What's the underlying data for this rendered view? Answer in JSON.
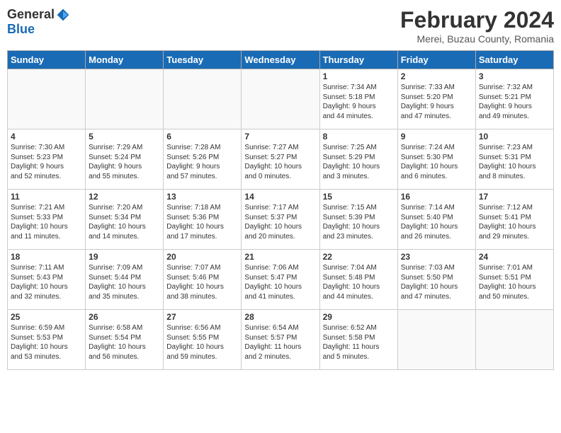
{
  "header": {
    "logo_general": "General",
    "logo_blue": "Blue",
    "month_year": "February 2024",
    "location": "Merei, Buzau County, Romania"
  },
  "weekdays": [
    "Sunday",
    "Monday",
    "Tuesday",
    "Wednesday",
    "Thursday",
    "Friday",
    "Saturday"
  ],
  "weeks": [
    [
      {
        "day": "",
        "info": ""
      },
      {
        "day": "",
        "info": ""
      },
      {
        "day": "",
        "info": ""
      },
      {
        "day": "",
        "info": ""
      },
      {
        "day": "1",
        "info": "Sunrise: 7:34 AM\nSunset: 5:18 PM\nDaylight: 9 hours\nand 44 minutes."
      },
      {
        "day": "2",
        "info": "Sunrise: 7:33 AM\nSunset: 5:20 PM\nDaylight: 9 hours\nand 47 minutes."
      },
      {
        "day": "3",
        "info": "Sunrise: 7:32 AM\nSunset: 5:21 PM\nDaylight: 9 hours\nand 49 minutes."
      }
    ],
    [
      {
        "day": "4",
        "info": "Sunrise: 7:30 AM\nSunset: 5:23 PM\nDaylight: 9 hours\nand 52 minutes."
      },
      {
        "day": "5",
        "info": "Sunrise: 7:29 AM\nSunset: 5:24 PM\nDaylight: 9 hours\nand 55 minutes."
      },
      {
        "day": "6",
        "info": "Sunrise: 7:28 AM\nSunset: 5:26 PM\nDaylight: 9 hours\nand 57 minutes."
      },
      {
        "day": "7",
        "info": "Sunrise: 7:27 AM\nSunset: 5:27 PM\nDaylight: 10 hours\nand 0 minutes."
      },
      {
        "day": "8",
        "info": "Sunrise: 7:25 AM\nSunset: 5:29 PM\nDaylight: 10 hours\nand 3 minutes."
      },
      {
        "day": "9",
        "info": "Sunrise: 7:24 AM\nSunset: 5:30 PM\nDaylight: 10 hours\nand 6 minutes."
      },
      {
        "day": "10",
        "info": "Sunrise: 7:23 AM\nSunset: 5:31 PM\nDaylight: 10 hours\nand 8 minutes."
      }
    ],
    [
      {
        "day": "11",
        "info": "Sunrise: 7:21 AM\nSunset: 5:33 PM\nDaylight: 10 hours\nand 11 minutes."
      },
      {
        "day": "12",
        "info": "Sunrise: 7:20 AM\nSunset: 5:34 PM\nDaylight: 10 hours\nand 14 minutes."
      },
      {
        "day": "13",
        "info": "Sunrise: 7:18 AM\nSunset: 5:36 PM\nDaylight: 10 hours\nand 17 minutes."
      },
      {
        "day": "14",
        "info": "Sunrise: 7:17 AM\nSunset: 5:37 PM\nDaylight: 10 hours\nand 20 minutes."
      },
      {
        "day": "15",
        "info": "Sunrise: 7:15 AM\nSunset: 5:39 PM\nDaylight: 10 hours\nand 23 minutes."
      },
      {
        "day": "16",
        "info": "Sunrise: 7:14 AM\nSunset: 5:40 PM\nDaylight: 10 hours\nand 26 minutes."
      },
      {
        "day": "17",
        "info": "Sunrise: 7:12 AM\nSunset: 5:41 PM\nDaylight: 10 hours\nand 29 minutes."
      }
    ],
    [
      {
        "day": "18",
        "info": "Sunrise: 7:11 AM\nSunset: 5:43 PM\nDaylight: 10 hours\nand 32 minutes."
      },
      {
        "day": "19",
        "info": "Sunrise: 7:09 AM\nSunset: 5:44 PM\nDaylight: 10 hours\nand 35 minutes."
      },
      {
        "day": "20",
        "info": "Sunrise: 7:07 AM\nSunset: 5:46 PM\nDaylight: 10 hours\nand 38 minutes."
      },
      {
        "day": "21",
        "info": "Sunrise: 7:06 AM\nSunset: 5:47 PM\nDaylight: 10 hours\nand 41 minutes."
      },
      {
        "day": "22",
        "info": "Sunrise: 7:04 AM\nSunset: 5:48 PM\nDaylight: 10 hours\nand 44 minutes."
      },
      {
        "day": "23",
        "info": "Sunrise: 7:03 AM\nSunset: 5:50 PM\nDaylight: 10 hours\nand 47 minutes."
      },
      {
        "day": "24",
        "info": "Sunrise: 7:01 AM\nSunset: 5:51 PM\nDaylight: 10 hours\nand 50 minutes."
      }
    ],
    [
      {
        "day": "25",
        "info": "Sunrise: 6:59 AM\nSunset: 5:53 PM\nDaylight: 10 hours\nand 53 minutes."
      },
      {
        "day": "26",
        "info": "Sunrise: 6:58 AM\nSunset: 5:54 PM\nDaylight: 10 hours\nand 56 minutes."
      },
      {
        "day": "27",
        "info": "Sunrise: 6:56 AM\nSunset: 5:55 PM\nDaylight: 10 hours\nand 59 minutes."
      },
      {
        "day": "28",
        "info": "Sunrise: 6:54 AM\nSunset: 5:57 PM\nDaylight: 11 hours\nand 2 minutes."
      },
      {
        "day": "29",
        "info": "Sunrise: 6:52 AM\nSunset: 5:58 PM\nDaylight: 11 hours\nand 5 minutes."
      },
      {
        "day": "",
        "info": ""
      },
      {
        "day": "",
        "info": ""
      }
    ]
  ]
}
